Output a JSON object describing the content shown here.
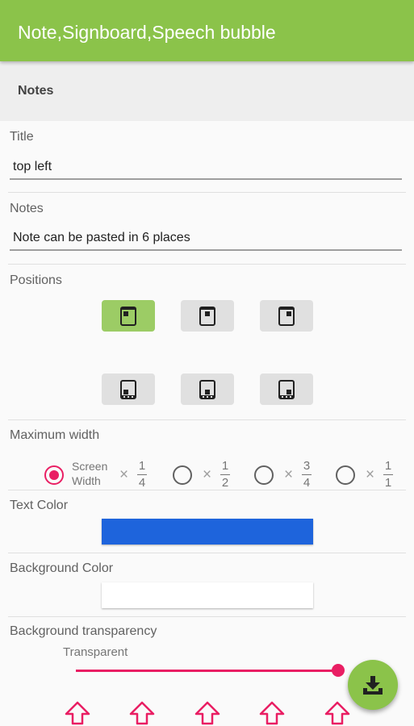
{
  "appbar": {
    "title": "Note,Signboard,Speech bubble"
  },
  "section": {
    "title": "Notes"
  },
  "title_field": {
    "label": "Title",
    "value": "top left"
  },
  "notes_field": {
    "label": "Notes",
    "value": "Note can be pasted in 6 places"
  },
  "positions": {
    "label": "Positions",
    "selected": "top-left",
    "options": [
      "top-left",
      "top-center",
      "top-right",
      "bottom-left",
      "bottom-center",
      "bottom-right"
    ]
  },
  "max_width": {
    "label": "Maximum width",
    "screen_label_line1": "Screen",
    "screen_label_line2": "Width",
    "times": "×",
    "options": [
      {
        "num": "1",
        "den": "4",
        "checked": true
      },
      {
        "num": "1",
        "den": "2",
        "checked": false
      },
      {
        "num": "3",
        "den": "4",
        "checked": false
      },
      {
        "num": "1",
        "den": "1",
        "checked": false
      }
    ]
  },
  "text_color": {
    "label": "Text Color",
    "color": "#1e64dc"
  },
  "background_color": {
    "label": "Background Color",
    "color": "#ffffff"
  },
  "transparency": {
    "label": "Background transparency",
    "value_label": "Transparent",
    "value": 1.0
  },
  "colors": {
    "accent": "#8bc34a",
    "accent_selected": "#9ccc65",
    "pink": "#e91e63"
  },
  "icons": {
    "fab": "download-icon",
    "bottom": "arrow-up-icon"
  }
}
